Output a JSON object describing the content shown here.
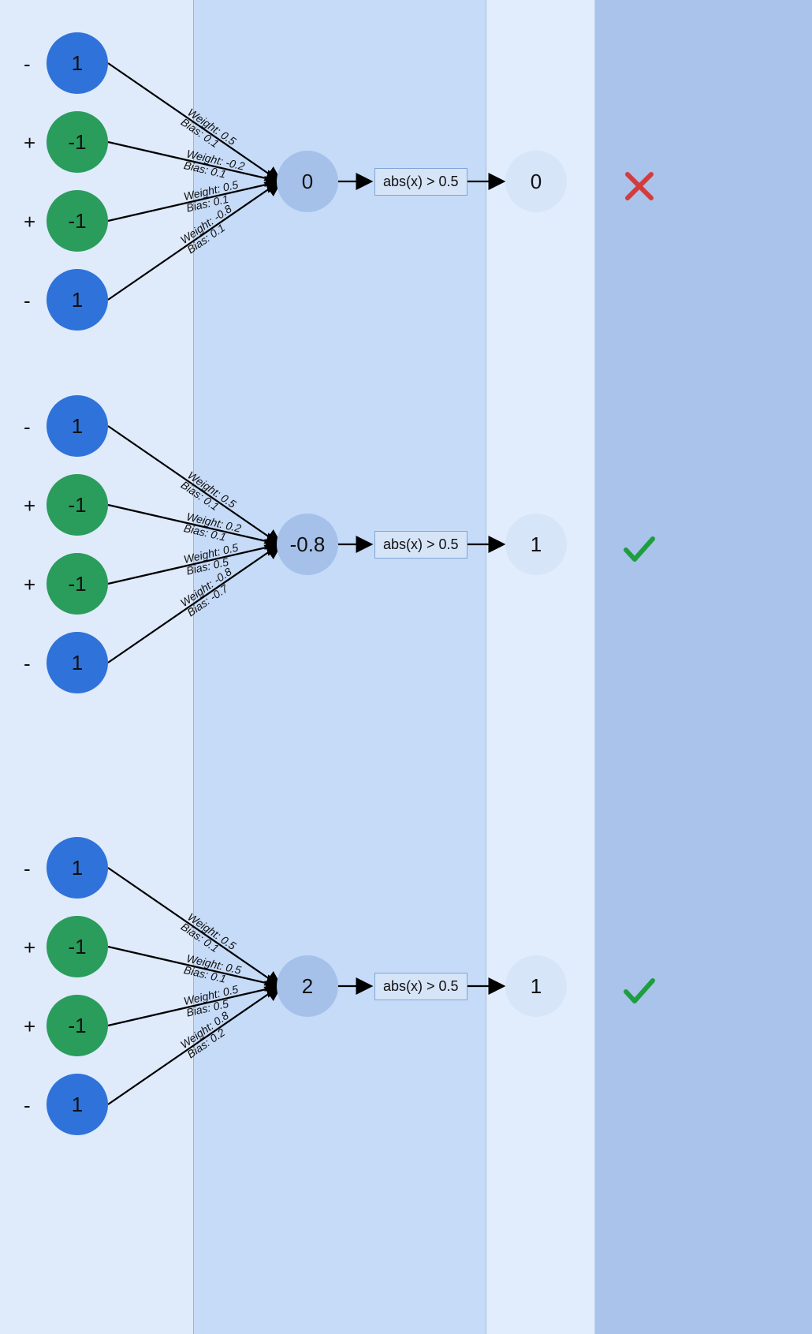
{
  "activation_label": "abs(x) > 0.5",
  "rows": [
    {
      "inputs": [
        {
          "sign": "-",
          "value": "1",
          "color": "blue"
        },
        {
          "sign": "+",
          "value": "-1",
          "color": "green"
        },
        {
          "sign": "+",
          "value": "-1",
          "color": "green"
        },
        {
          "sign": "-",
          "value": "1",
          "color": "blue"
        }
      ],
      "edges": [
        {
          "weight": "Weight: 0.5",
          "bias": "Bias: 0.1"
        },
        {
          "weight": "Weight: -0.2",
          "bias": "Bias: 0.1"
        },
        {
          "weight": "Weight: 0.5",
          "bias": "Bias: 0.1"
        },
        {
          "weight": "Weight: -0.8",
          "bias": "Bias: 0.1"
        }
      ],
      "hidden": "0",
      "output": "0",
      "result": "x"
    },
    {
      "inputs": [
        {
          "sign": "-",
          "value": "1",
          "color": "blue"
        },
        {
          "sign": "+",
          "value": "-1",
          "color": "green"
        },
        {
          "sign": "+",
          "value": "-1",
          "color": "green"
        },
        {
          "sign": "-",
          "value": "1",
          "color": "blue"
        }
      ],
      "edges": [
        {
          "weight": "Weight: 0.5",
          "bias": "Bias: 0.1"
        },
        {
          "weight": "Weight: 0.2",
          "bias": "Bias: 0.1"
        },
        {
          "weight": "Weight: 0.5",
          "bias": "Bias: 0.5"
        },
        {
          "weight": "Weight: -0.8",
          "bias": "Bias: -0.7"
        }
      ],
      "hidden": "-0.8",
      "output": "1",
      "result": "check"
    },
    {
      "inputs": [
        {
          "sign": "-",
          "value": "1",
          "color": "blue"
        },
        {
          "sign": "+",
          "value": "-1",
          "color": "green"
        },
        {
          "sign": "+",
          "value": "-1",
          "color": "green"
        },
        {
          "sign": "-",
          "value": "1",
          "color": "blue"
        }
      ],
      "edges": [
        {
          "weight": "Weight: 0.5",
          "bias": "Bias: 0.1"
        },
        {
          "weight": "Weight: 0.5",
          "bias": "Bias: 0.1"
        },
        {
          "weight": "Weight: 0.5",
          "bias": "Bias: 0.5"
        },
        {
          "weight": "Weight: 0.8",
          "bias": "Bias: 0.2"
        }
      ],
      "hidden": "2",
      "output": "1",
      "result": "check"
    }
  ],
  "chart_data": {
    "type": "table",
    "title": "Neural network forward-pass examples",
    "activation": "abs(x) > 0.5",
    "examples": [
      {
        "inputs": [
          1,
          -1,
          -1,
          1
        ],
        "weights": [
          0.5,
          -0.2,
          0.5,
          -0.8
        ],
        "biases": [
          0.1,
          0.1,
          0.1,
          0.1
        ],
        "hidden_sum": 0,
        "output": 0,
        "correct": false
      },
      {
        "inputs": [
          1,
          -1,
          -1,
          1
        ],
        "weights": [
          0.5,
          0.2,
          0.5,
          -0.8
        ],
        "biases": [
          0.1,
          0.1,
          0.5,
          -0.7
        ],
        "hidden_sum": -0.8,
        "output": 1,
        "correct": true
      },
      {
        "inputs": [
          1,
          -1,
          -1,
          1
        ],
        "weights": [
          0.5,
          0.5,
          0.5,
          0.8
        ],
        "biases": [
          0.1,
          0.1,
          0.5,
          0.2
        ],
        "hidden_sum": 2,
        "output": 1,
        "correct": true
      }
    ]
  }
}
